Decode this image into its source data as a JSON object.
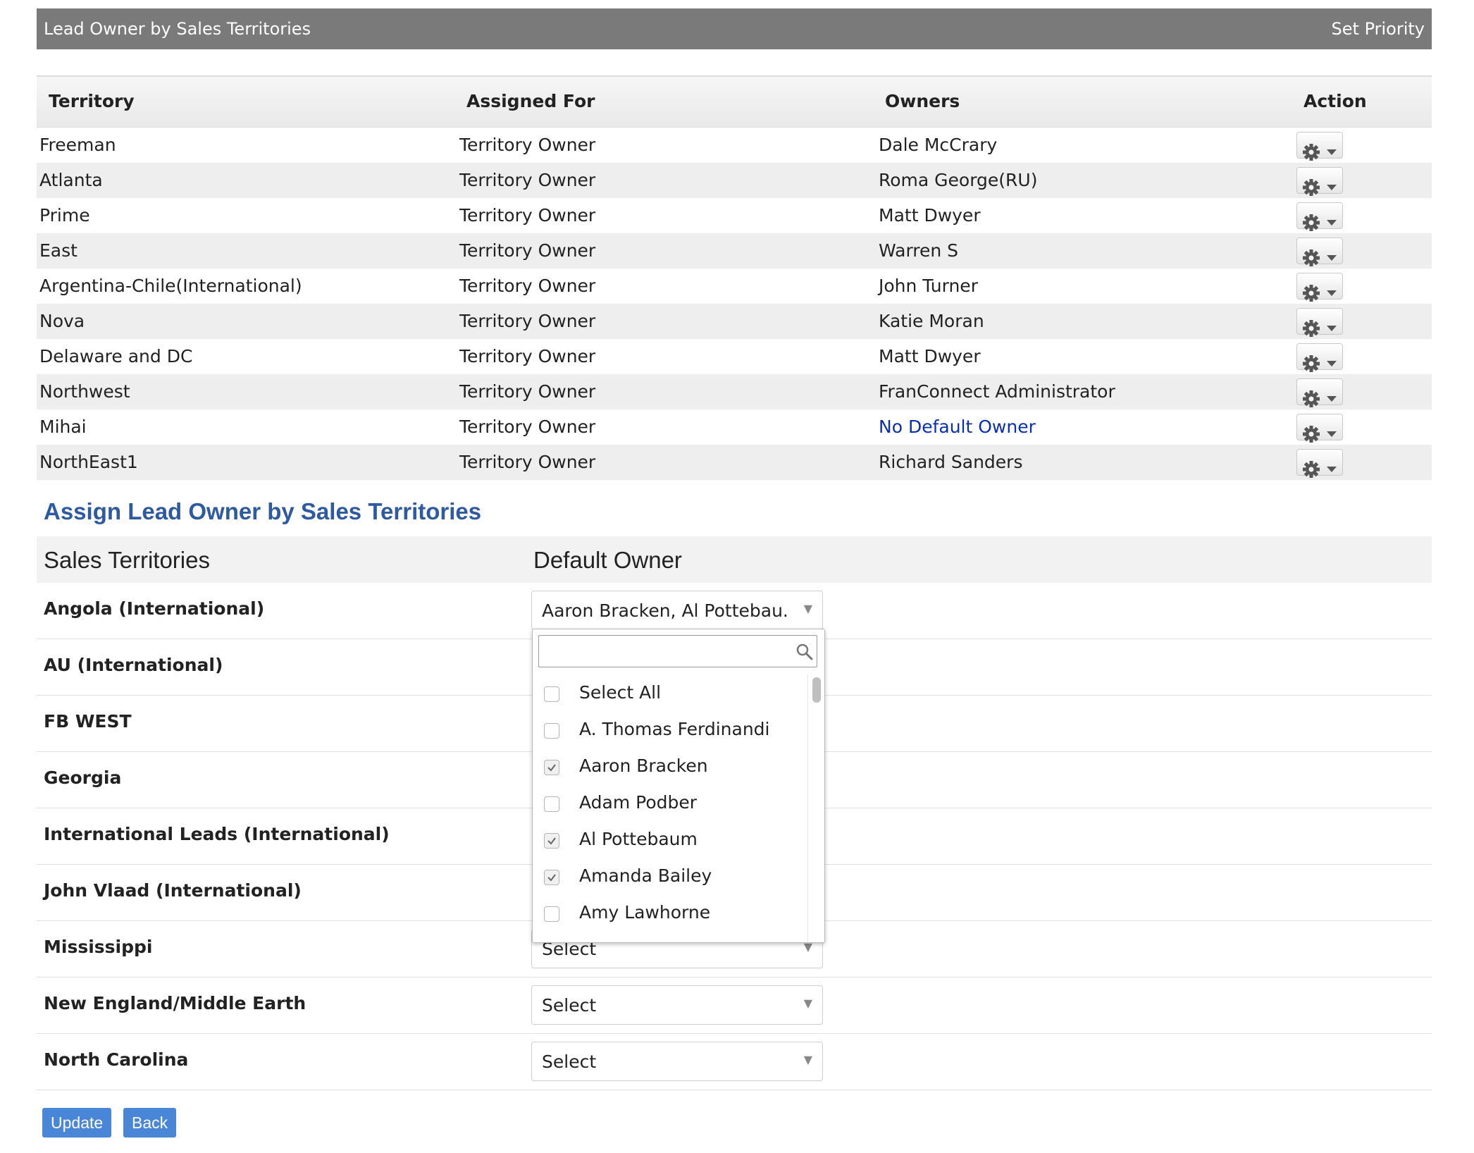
{
  "header": {
    "title": "Lead Owner by Sales Territories",
    "set_priority": "Set Priority"
  },
  "table": {
    "columns": [
      "Territory",
      "Assigned For",
      "Owners",
      "Action"
    ],
    "rows": [
      {
        "territory": "Freeman",
        "assigned": "Territory Owner",
        "owner": "Dale McCrary"
      },
      {
        "territory": "Atlanta",
        "assigned": "Territory Owner",
        "owner": "Roma George(RU)"
      },
      {
        "territory": "Prime",
        "assigned": "Territory Owner",
        "owner": "Matt Dwyer"
      },
      {
        "territory": "East",
        "assigned": "Territory Owner",
        "owner": "Warren S"
      },
      {
        "territory": "Argentina-Chile(International)",
        "assigned": "Territory Owner",
        "owner": "John Turner"
      },
      {
        "territory": "Nova",
        "assigned": "Territory Owner",
        "owner": "Katie Moran"
      },
      {
        "territory": "Delaware and DC",
        "assigned": "Territory Owner",
        "owner": "Matt Dwyer"
      },
      {
        "territory": "Northwest",
        "assigned": "Territory Owner",
        "owner": "FranConnect Administrator"
      },
      {
        "territory": "Mihai",
        "assigned": "Territory Owner",
        "owner": "No Default Owner"
      },
      {
        "territory": "NorthEast1",
        "assigned": "Territory Owner",
        "owner": "Richard Sanders"
      }
    ]
  },
  "assign": {
    "title": "Assign Lead Owner by Sales Territories",
    "col_territories": "Sales Territories",
    "col_default_owner": "Default Owner",
    "rows": [
      {
        "label": "Angola (International)",
        "value": "Aaron Bracken, Al Pottebau..."
      },
      {
        "label": "AU (International)",
        "value": ""
      },
      {
        "label": "FB WEST",
        "value": ""
      },
      {
        "label": "Georgia",
        "value": ""
      },
      {
        "label": "International Leads (International)",
        "value": ""
      },
      {
        "label": "John Vlaad (International)",
        "value": ""
      },
      {
        "label": "Mississippi",
        "value": "Select"
      },
      {
        "label": "New England/Middle Earth",
        "value": "Select"
      },
      {
        "label": "North Carolina",
        "value": "Select"
      }
    ]
  },
  "dropdown": {
    "search_value": "",
    "items": [
      {
        "label": "Select All",
        "checked": false
      },
      {
        "label": "A. Thomas Ferdinandi",
        "checked": false
      },
      {
        "label": "Aaron Bracken",
        "checked": true
      },
      {
        "label": "Adam Podber",
        "checked": false
      },
      {
        "label": "Al Pottebaum",
        "checked": true
      },
      {
        "label": "Amanda Bailey",
        "checked": true
      },
      {
        "label": "Amy Lawhorne",
        "checked": false
      }
    ]
  },
  "buttons": {
    "update": "Update",
    "back": "Back"
  },
  "colors": {
    "header_bg": "#7a7a7a",
    "link": "#0a2fb4",
    "section_title": "#2d5aa0",
    "button": "#4a86d8"
  }
}
